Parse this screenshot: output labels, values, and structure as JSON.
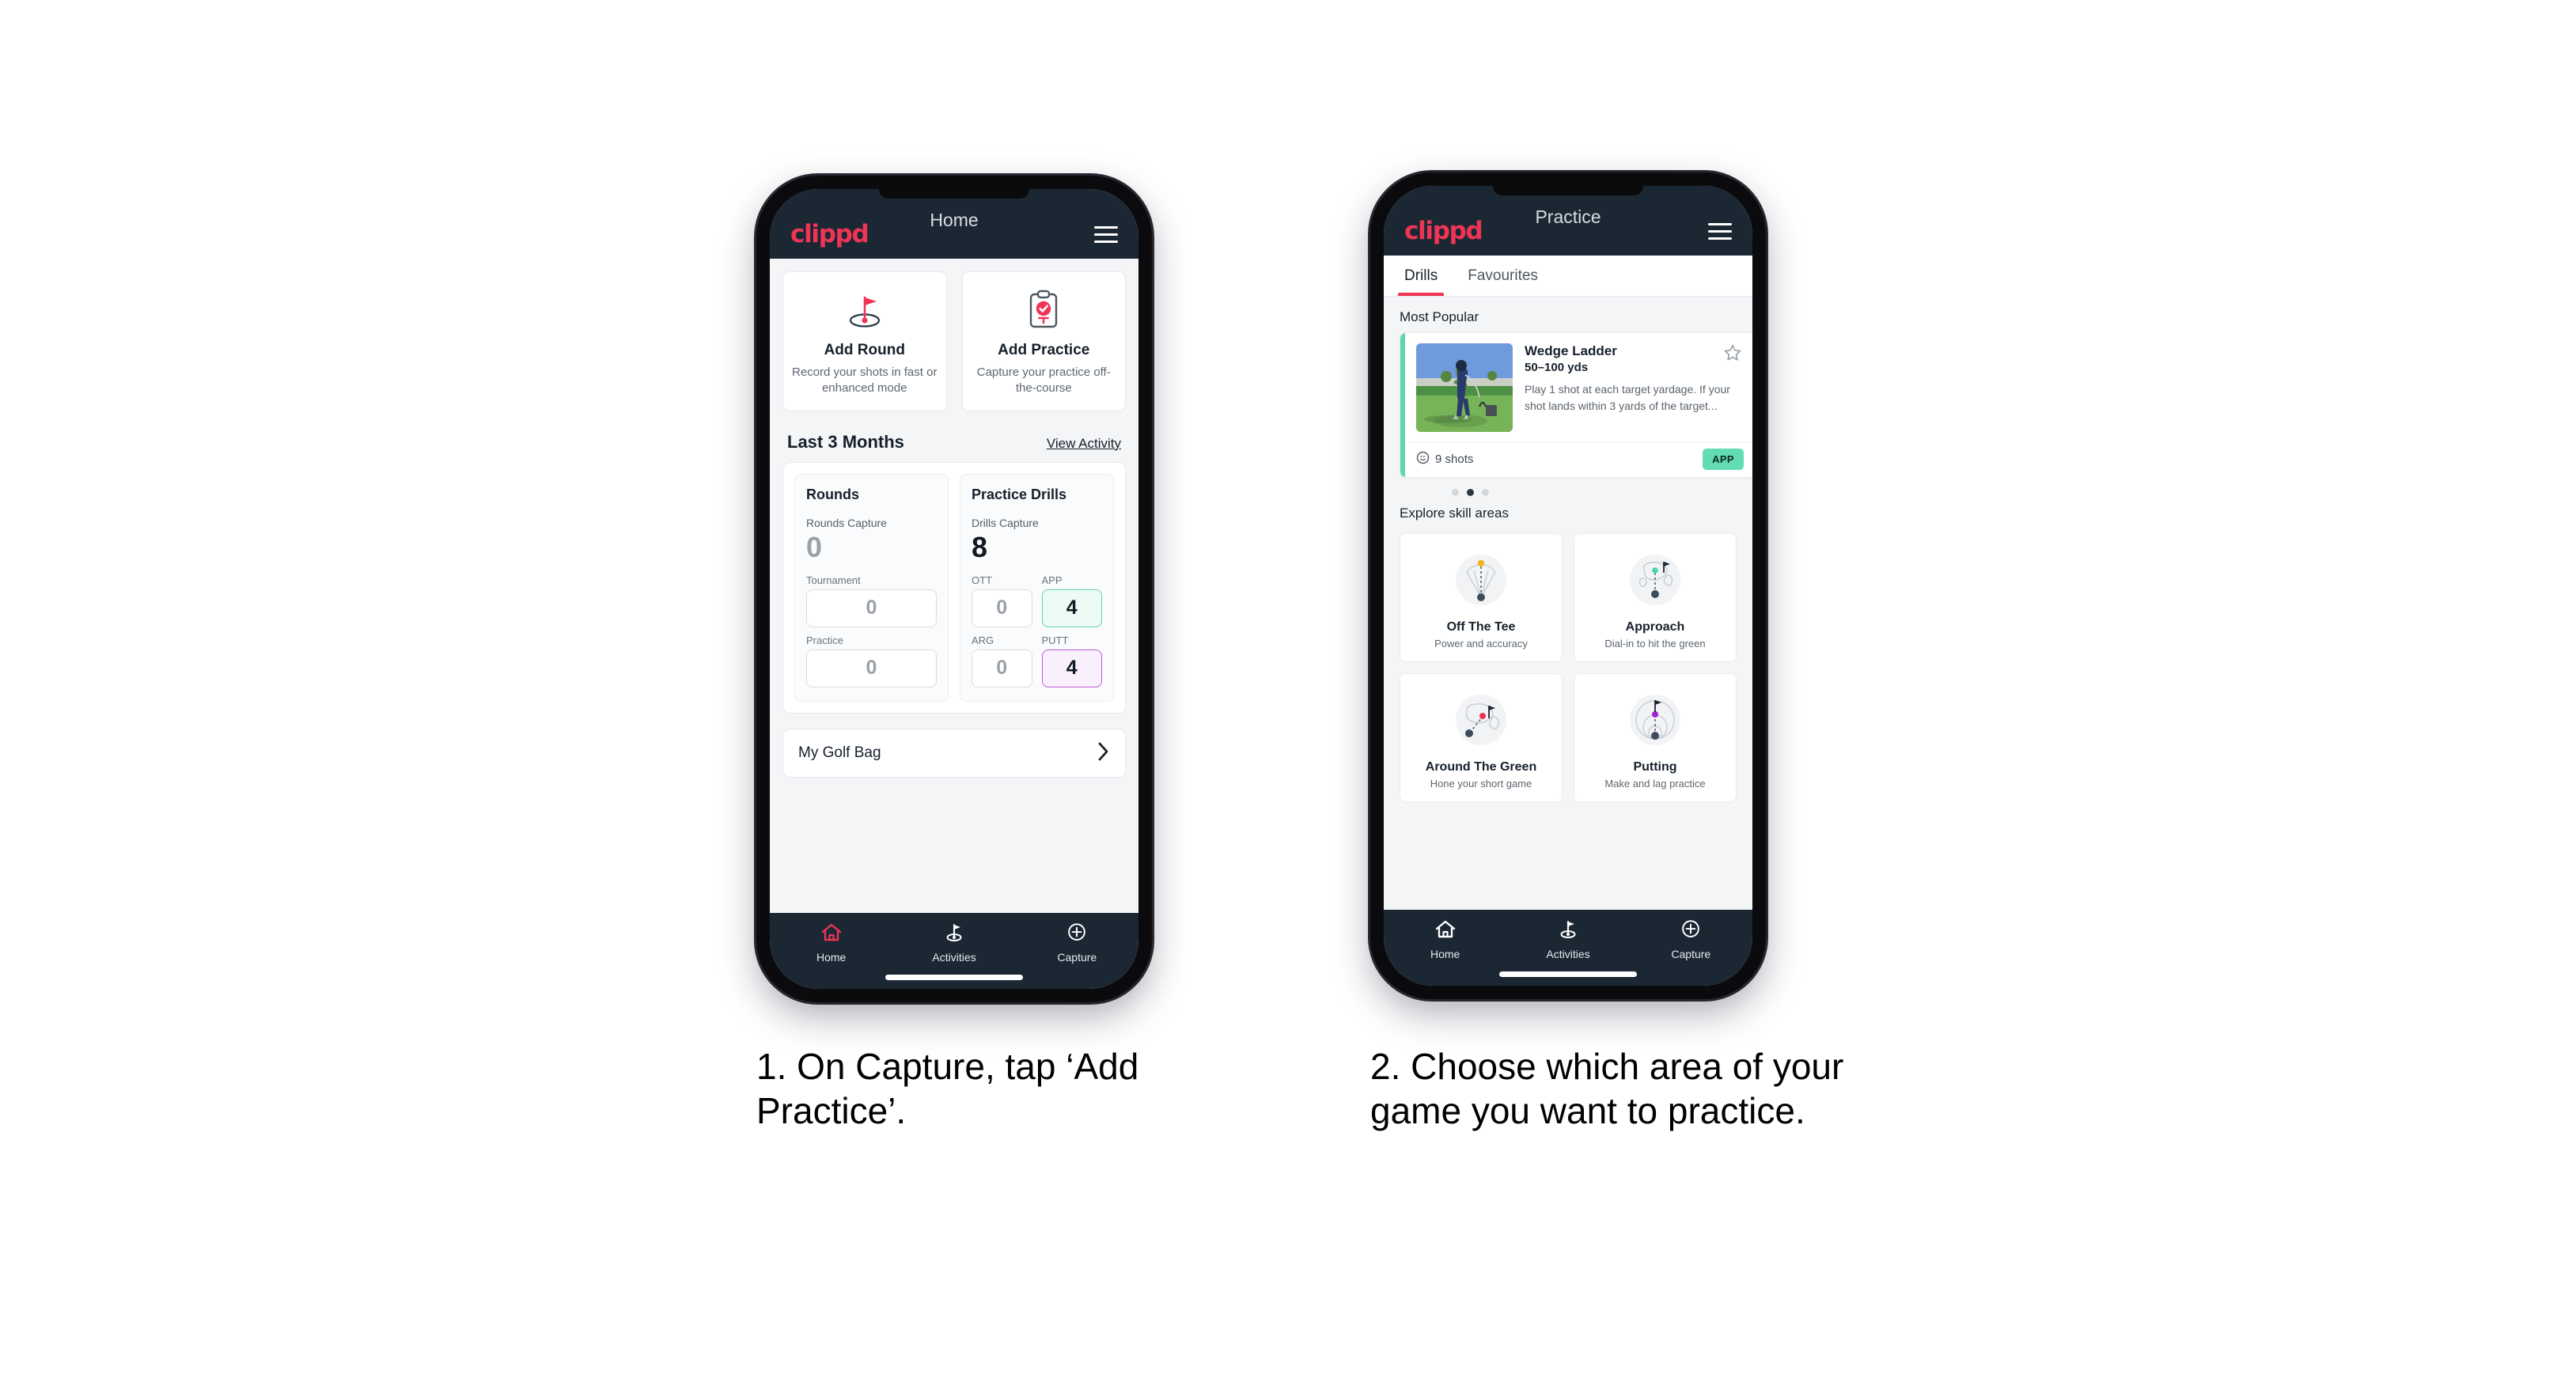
{
  "brand": "clippd",
  "phone1": {
    "appbar": {
      "title": "Home",
      "menu_icon": "hamburger-icon"
    },
    "quick_actions": [
      {
        "icon": "golf-flag-hole-icon",
        "title": "Add Round",
        "subtitle": "Record your shots in fast or enhanced mode"
      },
      {
        "icon": "clipboard-check-tee-icon",
        "title": "Add Practice",
        "subtitle": "Capture your practice off-the-course"
      }
    ],
    "section": {
      "title": "Last 3 Months",
      "link": "View Activity"
    },
    "stats": {
      "rounds": {
        "heading": "Rounds",
        "capture_label": "Rounds Capture",
        "capture_value": "0",
        "boxes": [
          {
            "label": "Tournament",
            "value": "0",
            "state": "empty"
          },
          {
            "label": "Practice",
            "value": "0",
            "state": "empty"
          }
        ]
      },
      "drills": {
        "heading": "Practice Drills",
        "capture_label": "Drills Capture",
        "capture_value": "8",
        "boxes": [
          {
            "label": "OTT",
            "value": "0",
            "state": "empty"
          },
          {
            "label": "APP",
            "value": "4",
            "state": "app"
          },
          {
            "label": "ARG",
            "value": "0",
            "state": "empty"
          },
          {
            "label": "PUTT",
            "value": "4",
            "state": "putt"
          }
        ]
      }
    },
    "golf_bag": {
      "label": "My Golf Bag",
      "chevron": "chevron-right-icon"
    },
    "nav": [
      {
        "icon": "home-icon",
        "label": "Home",
        "active": true
      },
      {
        "icon": "golf-flag-icon",
        "label": "Activities",
        "active": false
      },
      {
        "icon": "plus-circle-icon",
        "label": "Capture",
        "active": false
      }
    ]
  },
  "phone2": {
    "appbar": {
      "title": "Practice",
      "menu_icon": "hamburger-icon"
    },
    "tabs": [
      {
        "label": "Drills",
        "active": true
      },
      {
        "label": "Favourites",
        "active": false
      }
    ],
    "most_popular_label": "Most Popular",
    "drill": {
      "name": "Wedge Ladder",
      "yardage": "50–100 yds",
      "description": "Play 1 shot at each target yardage. If your shot lands within 3 yards of the target...",
      "shots": "9 shots",
      "shots_icon": "golf-ball-icon",
      "badge": "APP",
      "favourite_icon": "star-outline-icon",
      "accent_color": "#5fd7ad",
      "next_accent_color": "#b233e0"
    },
    "carousel_dots": {
      "count": 3,
      "active_index": 1
    },
    "explore_label": "Explore skill areas",
    "skills": [
      {
        "icon": "tee-shot-fan-icon",
        "name": "Off The Tee",
        "subtitle": "Power and accuracy",
        "dot_color": "#f2b322"
      },
      {
        "icon": "approach-green-icon",
        "name": "Approach",
        "subtitle": "Dial-in to hit the green",
        "dot_color": "#46d3b4"
      },
      {
        "icon": "around-green-icon",
        "name": "Around The Green",
        "subtitle": "Hone your short game",
        "dot_color": "#ef3456"
      },
      {
        "icon": "putting-rings-icon",
        "name": "Putting",
        "subtitle": "Make and lag practice",
        "dot_color": "#a61fd4"
      }
    ],
    "nav": [
      {
        "icon": "home-icon",
        "label": "Home",
        "active": false
      },
      {
        "icon": "golf-flag-icon",
        "label": "Activities",
        "active": false
      },
      {
        "icon": "plus-circle-icon",
        "label": "Capture",
        "active": false
      }
    ]
  },
  "captions": {
    "one": "1. On Capture, tap ‘Add Practice’.",
    "two": "2. Choose which area of your game you want to practice."
  },
  "colors": {
    "brand_pink": "#ef3456",
    "dark_navy": "#1b2733",
    "app_green": "#5fd7ad",
    "putt_purple": "#c259d8",
    "page_bg": "#f4f5f7"
  }
}
